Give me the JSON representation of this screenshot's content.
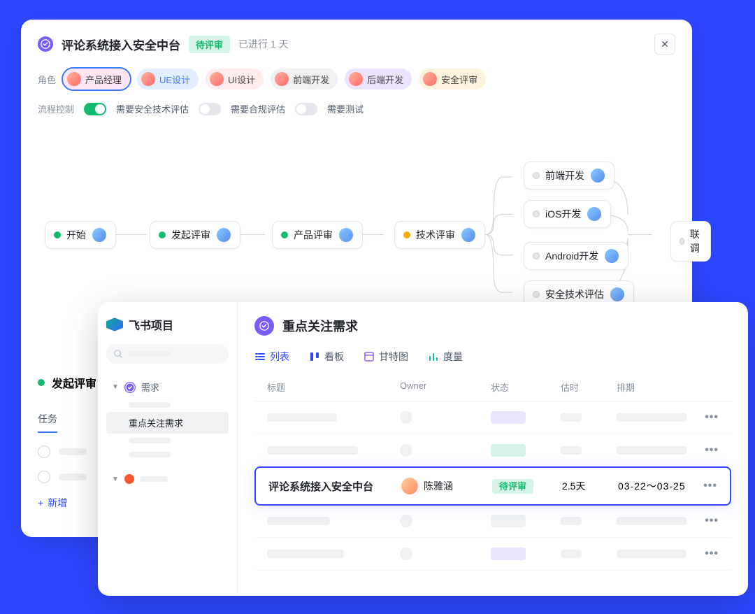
{
  "workflow": {
    "title": "评论系统接入安全中台",
    "status_badge": "待评审",
    "days_text": "已进行 1 天",
    "roles_label": "角色",
    "roles": [
      {
        "label": "产品经理",
        "cls": "r1 selected"
      },
      {
        "label": "UE设计",
        "cls": "r2"
      },
      {
        "label": "UI设计",
        "cls": "r3"
      },
      {
        "label": "前端开发",
        "cls": "r4"
      },
      {
        "label": "后端开发",
        "cls": "r5"
      },
      {
        "label": "安全评审",
        "cls": "r6"
      }
    ],
    "flow_control": {
      "label": "流程控制",
      "opts": [
        {
          "label": "需要安全技术评估",
          "on": true
        },
        {
          "label": "需要合规评估",
          "on": false
        },
        {
          "label": "需要测试",
          "on": false
        }
      ]
    },
    "nodes": {
      "start": "开始",
      "initiate": "发起评审",
      "product": "产品评审",
      "tech": "技术评审",
      "fe": "前端开发",
      "ios": "iOS开发",
      "android": "Android开发",
      "sec": "安全技术评估",
      "joint": "联调"
    },
    "lower": {
      "title": "发起评审",
      "tab": "任务",
      "add_btn": "新增"
    }
  },
  "project": {
    "logo_text": "飞书项目",
    "sidebar": {
      "requirements": "需求",
      "focus": "重点关注需求"
    },
    "main_title": "重点关注需求",
    "tabs": {
      "list": "列表",
      "kanban": "看板",
      "gantt": "甘特图",
      "metrics": "度量"
    },
    "columns": {
      "title": "标题",
      "owner": "Owner",
      "status": "状态",
      "estimate": "估时",
      "schedule": "排期"
    },
    "highlight_row": {
      "title": "评论系统接入安全中台",
      "owner": "陈雅涵",
      "status": "待评审",
      "estimate": "2.5天",
      "schedule": "03-22～03-25"
    }
  }
}
